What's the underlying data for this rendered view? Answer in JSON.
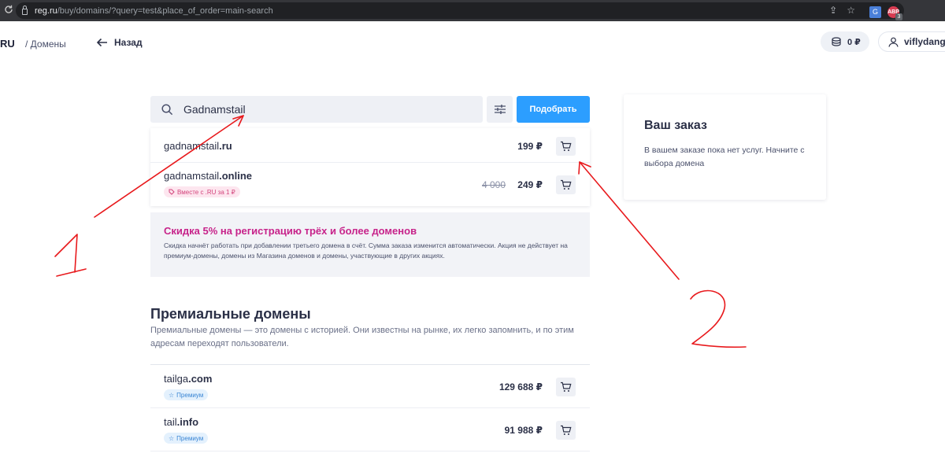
{
  "browser": {
    "url_host": "reg.ru",
    "url_path": "/buy/domains/?query=test&place_of_order=main-search",
    "ext_badge": "3",
    "ext_label": "ABP"
  },
  "header": {
    "logo": "RU",
    "breadcrumb": "/ Домены",
    "back_label": "Назад",
    "balance": "0 ₽",
    "username": "viflydange"
  },
  "search": {
    "value": "Gadnamstail",
    "submit_label": "Подобрать"
  },
  "results": [
    {
      "name": "gadnamstail",
      "tld": ".ru",
      "price": "199 ₽"
    },
    {
      "name": "gadnamstail",
      "tld": ".online",
      "old_price": "4 000",
      "price": "249 ₽",
      "tag": "Вместе с .RU за 1 ₽"
    }
  ],
  "promo": {
    "title": "Скидка 5% на регистрацию трёх и более доменов",
    "text": "Скидка начнёт работать при добавлении третьего домена в счёт. Сумма заказа изменится автоматически. Акция не действует на премиум-домены, домены из Магазина доменов и домены, участвующие в других акциях."
  },
  "premium": {
    "title": "Премиальные домены",
    "description": "Премиальные домены — это домены с историей. Они известны на рынке, их легко запомнить, и по этим адресам переходят пользователи.",
    "items": [
      {
        "name": "tailga",
        "tld": ".com",
        "price": "129 688 ₽",
        "tag": "Премиум"
      },
      {
        "name": "tail",
        "tld": ".info",
        "price": "91 988 ₽",
        "tag": "Премиум"
      }
    ]
  },
  "order": {
    "title": "Ваш заказ",
    "text": "В вашем заказе пока нет услуг. Начните с выбора домена"
  },
  "annotations": {
    "label_1": "1",
    "label_2": "2",
    "color": "#e8191c"
  },
  "colors": {
    "accent": "#2c9eff",
    "promo_title": "#c7238a"
  }
}
